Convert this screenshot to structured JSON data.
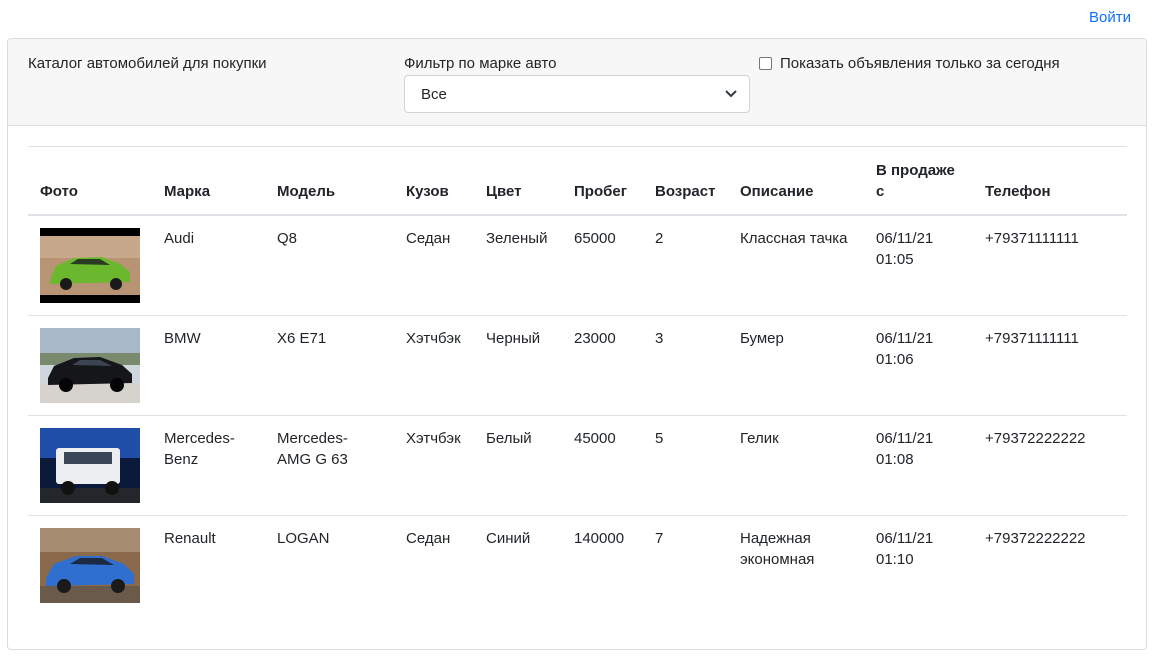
{
  "header": {
    "login_label": "Войти"
  },
  "catalog": {
    "title": "Каталог автомобилей для покупки",
    "filter_label": "Фильтр по марке авто",
    "filter_value": "Все",
    "today_checkbox_label": "Показать объявления только за сегодня",
    "today_checked": false
  },
  "table": {
    "columns": [
      "Фото",
      "Марка",
      "Модель",
      "Кузов",
      "Цвет",
      "Пробег",
      "Возраст",
      "Описание",
      "В продаже с",
      "Телефон"
    ],
    "rows": [
      {
        "brand": "Audi",
        "model": "Q8",
        "body": "Седан",
        "color": "Зеленый",
        "mileage": "65000",
        "age": "2",
        "description": "Классная тачка",
        "on_sale_since": "06/11/21 01:05",
        "phone": "+79371111111",
        "photo_icon": "green-audi-q8-photo"
      },
      {
        "brand": "BMW",
        "model": "X6 E71",
        "body": "Хэтчбэк",
        "color": "Черный",
        "mileage": "23000",
        "age": "3",
        "description": "Бумер",
        "on_sale_since": "06/11/21 01:06",
        "phone": "+79371111111",
        "photo_icon": "black-bmw-x6-photo"
      },
      {
        "brand": "Mercedes-Benz",
        "model": "Mercedes-AMG G 63",
        "body": "Хэтчбэк",
        "color": "Белый",
        "mileage": "45000",
        "age": "5",
        "description": "Гелик",
        "on_sale_since": "06/11/21 01:08",
        "phone": "+79372222222",
        "photo_icon": "white-mercedes-g63-photo"
      },
      {
        "brand": "Renault",
        "model": "LOGAN",
        "body": "Седан",
        "color": "Синий",
        "mileage": "140000",
        "age": "7",
        "description": "Надежная экономная",
        "on_sale_since": "06/11/21 01:10",
        "phone": "+79372222222",
        "photo_icon": "blue-renault-logan-photo"
      }
    ]
  },
  "colors": {
    "link": "#0d6efd",
    "header_bg": "#f7f7f7",
    "border": "#dee2e6"
  }
}
